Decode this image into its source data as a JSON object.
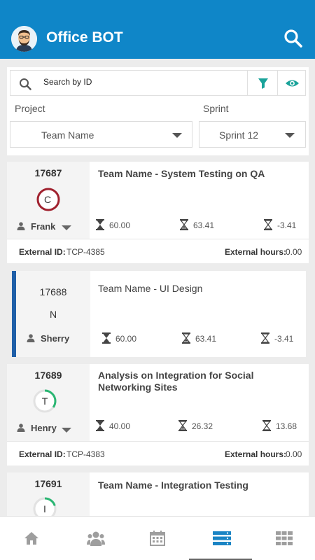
{
  "app": {
    "title": "Office BOT"
  },
  "search": {
    "placeholder": "Search by ID"
  },
  "filters": {
    "project_label": "Project",
    "project_value": "Team Name",
    "sprint_label": "Sprint",
    "sprint_value": "Sprint 12"
  },
  "colors": {
    "brand": "#0f86c8",
    "accent_teal": "#1aa39a",
    "selected_bar": "#1f5fa8",
    "ring_red": "#a0212e",
    "ring_green": "#2bb673"
  },
  "cards": [
    {
      "id": "17687",
      "title": "Team Name - System Testing on QA",
      "initial": "C",
      "owner": "Frank",
      "stats": [
        "60.00",
        "63.41",
        "-3.41"
      ],
      "ext_id_label": "External ID:",
      "ext_id": "TCP-4385",
      "ext_hours_label": "External hours:",
      "ext_hours": "0.00",
      "progress": 1.0
    },
    {
      "id": "17688",
      "title": "Team Name - UI Design",
      "initial": "N",
      "owner": "Sherry",
      "stats": [
        "60.00",
        "63.41",
        "-3.41"
      ],
      "selected": true
    },
    {
      "id": "17689",
      "title": "Analysis on Integration for Social Networking Sites",
      "initial": "T",
      "owner": "Henry",
      "stats": [
        "40.00",
        "26.32",
        "13.68"
      ],
      "ext_id_label": "External ID:",
      "ext_id": "TCP-4383",
      "ext_hours_label": "External hours:",
      "ext_hours": "0.00",
      "progress": 0.35
    },
    {
      "id": "17691",
      "title": "Team Name - Integration Testing",
      "initial": "I",
      "progress": 0.2
    }
  ],
  "nav": [
    "home-icon",
    "team-icon",
    "calendar-icon",
    "tasks-icon",
    "apps-icon"
  ],
  "nav_active": "tasks-icon"
}
